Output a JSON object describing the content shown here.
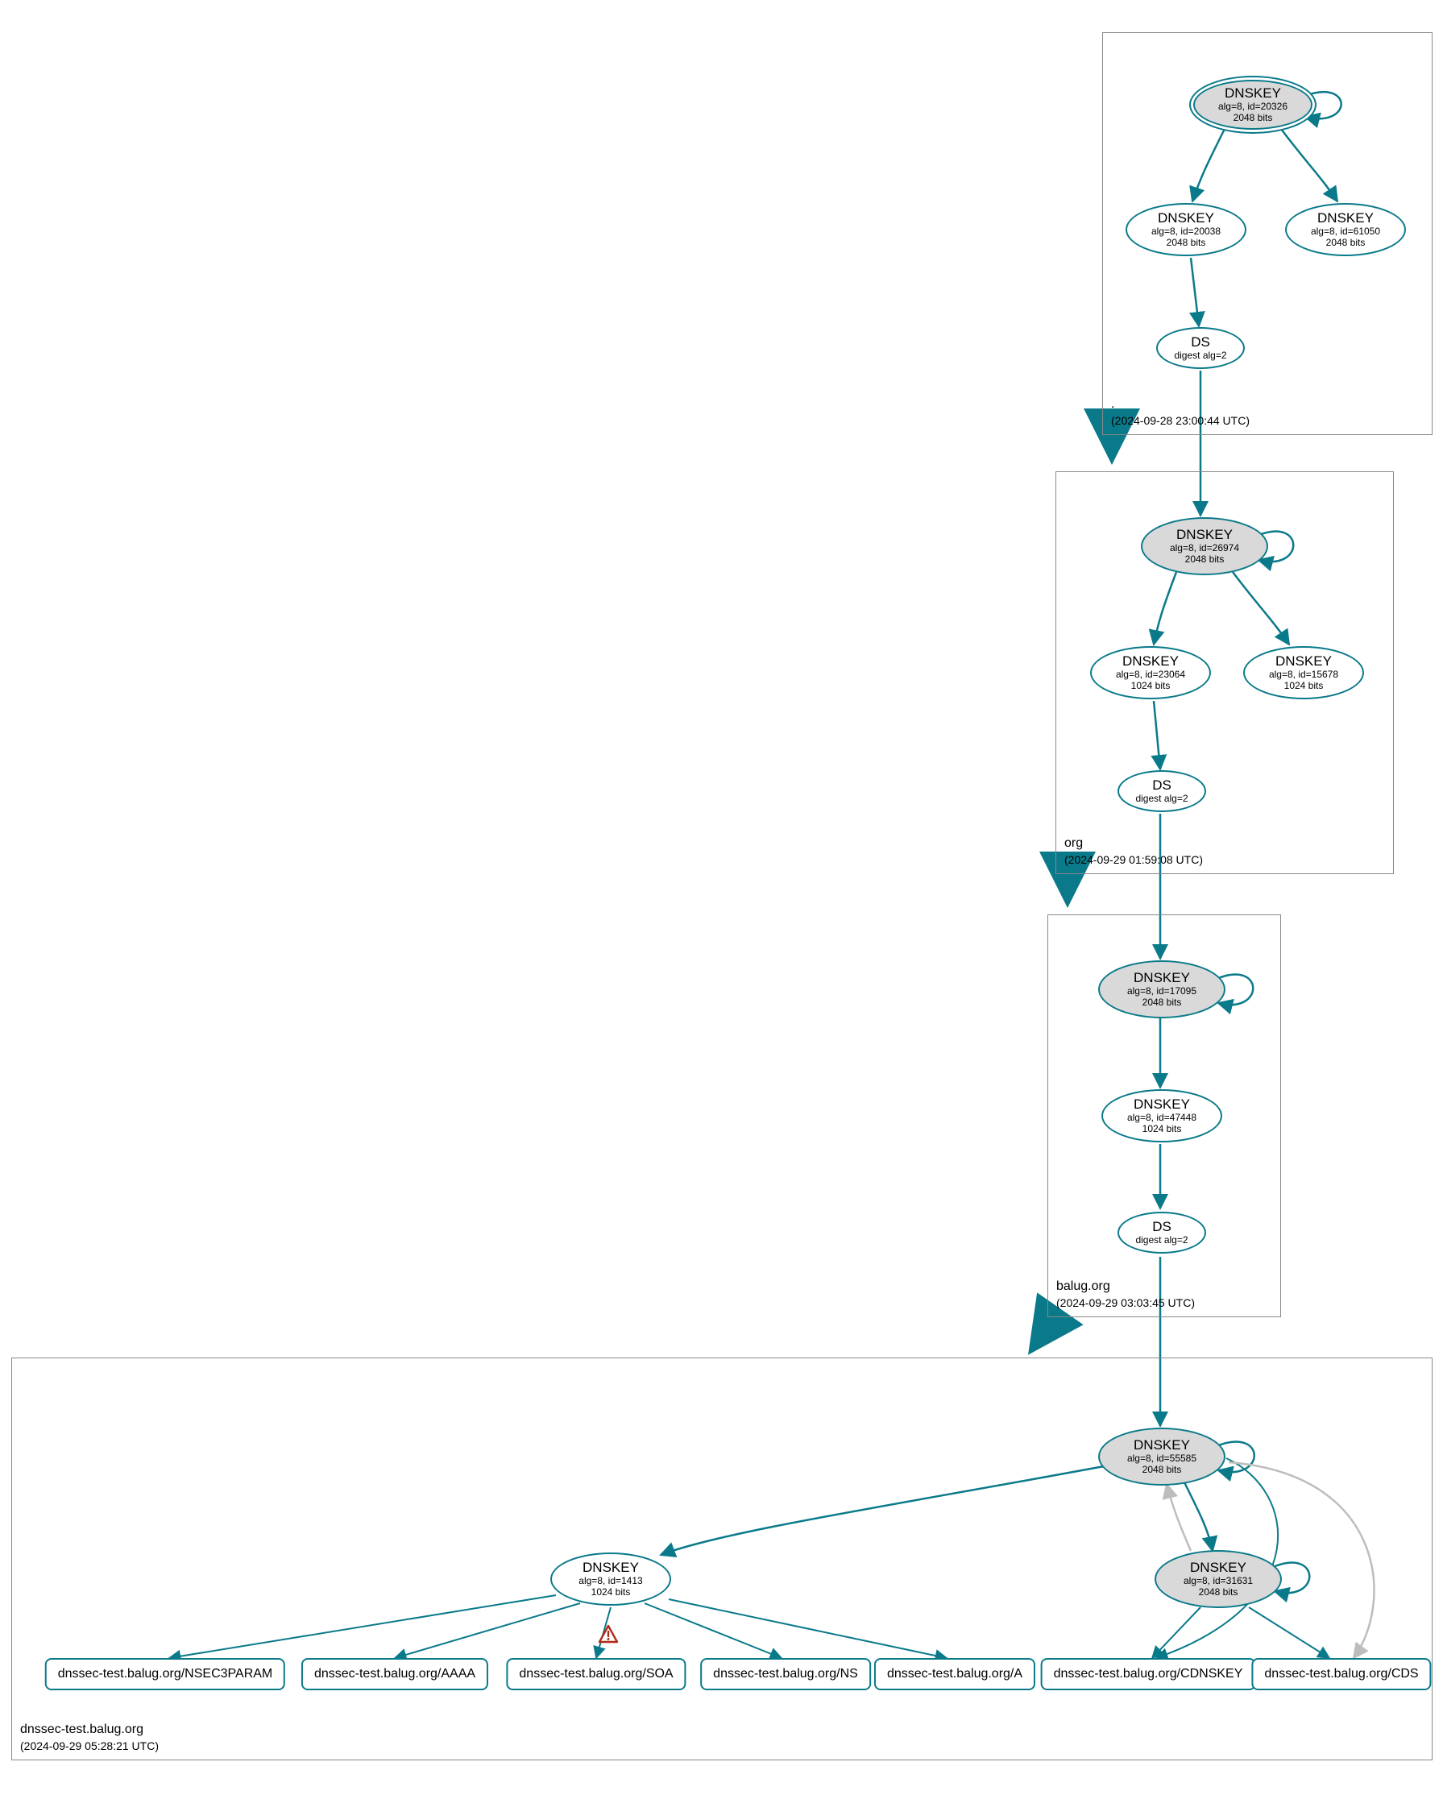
{
  "zones": {
    "root": {
      "name": ".",
      "timestamp": "(2024-09-28 23:00:44 UTC)"
    },
    "org": {
      "name": "org",
      "timestamp": "(2024-09-29 01:59:08 UTC)"
    },
    "balug": {
      "name": "balug.org",
      "timestamp": "(2024-09-29 03:03:45 UTC)"
    },
    "dnssectest": {
      "name": "dnssec-test.balug.org",
      "timestamp": "(2024-09-29 05:28:21 UTC)"
    }
  },
  "nodes": {
    "root_ksk": {
      "title": "DNSKEY",
      "line1": "alg=8, id=20326",
      "line2": "2048 bits"
    },
    "root_zsk1": {
      "title": "DNSKEY",
      "line1": "alg=8, id=20038",
      "line2": "2048 bits"
    },
    "root_zsk2": {
      "title": "DNSKEY",
      "line1": "alg=8, id=61050",
      "line2": "2048 bits"
    },
    "root_ds": {
      "title": "DS",
      "line1": "digest alg=2",
      "line2": ""
    },
    "org_ksk": {
      "title": "DNSKEY",
      "line1": "alg=8, id=26974",
      "line2": "2048 bits"
    },
    "org_zsk1": {
      "title": "DNSKEY",
      "line1": "alg=8, id=23064",
      "line2": "1024 bits"
    },
    "org_zsk2": {
      "title": "DNSKEY",
      "line1": "alg=8, id=15678",
      "line2": "1024 bits"
    },
    "org_ds": {
      "title": "DS",
      "line1": "digest alg=2",
      "line2": ""
    },
    "balug_ksk": {
      "title": "DNSKEY",
      "line1": "alg=8, id=17095",
      "line2": "2048 bits"
    },
    "balug_zsk": {
      "title": "DNSKEY",
      "line1": "alg=8, id=47448",
      "line2": "1024 bits"
    },
    "balug_ds": {
      "title": "DS",
      "line1": "digest alg=2",
      "line2": ""
    },
    "dt_ksk": {
      "title": "DNSKEY",
      "line1": "alg=8, id=55585",
      "line2": "2048 bits"
    },
    "dt_zsk": {
      "title": "DNSKEY",
      "line1": "alg=8, id=1413",
      "line2": "1024 bits"
    },
    "dt_zsk2": {
      "title": "DNSKEY",
      "line1": "alg=8, id=31631",
      "line2": "2048 bits"
    }
  },
  "records": {
    "nsec3param": "dnssec-test.balug.org/NSEC3PARAM",
    "aaaa": "dnssec-test.balug.org/AAAA",
    "soa": "dnssec-test.balug.org/SOA",
    "ns": "dnssec-test.balug.org/NS",
    "a": "dnssec-test.balug.org/A",
    "cdnskey": "dnssec-test.balug.org/CDNSKEY",
    "cds": "dnssec-test.balug.org/CDS"
  },
  "colors": {
    "stroke": "#0a7a8a",
    "grayfill": "#d9d9d9",
    "warn_stroke": "#b02a1a",
    "warn_fill": "#ffffff"
  }
}
